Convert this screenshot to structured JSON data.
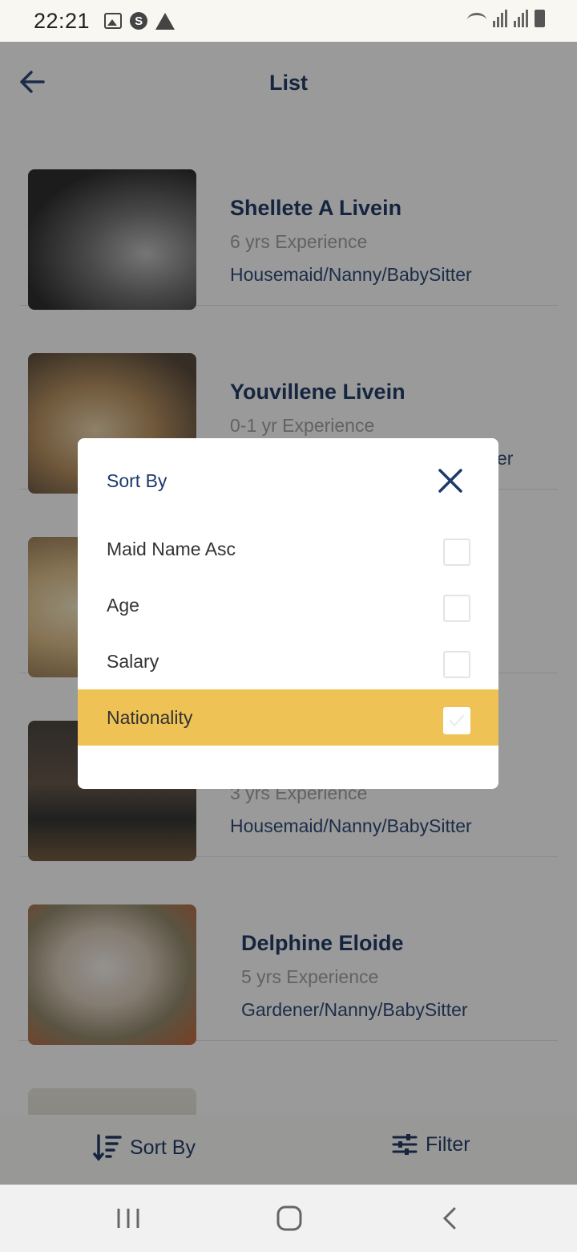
{
  "status_bar": {
    "time": "22:21"
  },
  "header": {
    "title": "List"
  },
  "list": {
    "items": [
      {
        "name": "Shellete A Livein",
        "experience": "6 yrs Experience",
        "role": "Housemaid/Nanny/BabySitter"
      },
      {
        "name": "Youvillene Livein",
        "experience": "0-1 yr Experience",
        "role": "er"
      },
      {
        "name": "",
        "experience": "3 yrs Experience",
        "role": "Housemaid/Nanny/BabySitter"
      },
      {
        "name": "Delphine Eloide",
        "experience": "5 yrs Experience",
        "role": "Gardener/Nanny/BabySitter"
      }
    ]
  },
  "bottom_bar": {
    "sort_label": "Sort By",
    "filter_label": "Filter"
  },
  "modal": {
    "title": "Sort By",
    "options": [
      {
        "label": "Maid Name Asc",
        "checked": false
      },
      {
        "label": "Age",
        "checked": false
      },
      {
        "label": "Salary",
        "checked": false
      },
      {
        "label": "Nationality",
        "checked": true
      }
    ]
  },
  "colors": {
    "accent_yellow": "#efc255",
    "navy": "#0e2a59"
  }
}
